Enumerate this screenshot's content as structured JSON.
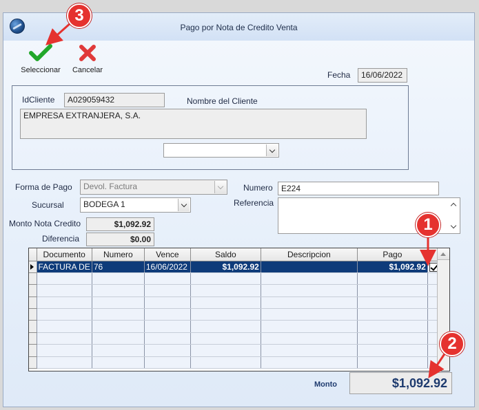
{
  "window": {
    "title": "Pago por Nota de Credito Venta"
  },
  "toolbar": {
    "select_label": "Seleccionar",
    "cancel_label": "Cancelar"
  },
  "header": {
    "fecha_label": "Fecha",
    "fecha_value": "16/06/2022"
  },
  "client": {
    "id_label": "IdCliente",
    "id_value": "A029059432",
    "name_label": "Nombre del Cliente",
    "name_value": "EMPRESA EXTRANJERA, S.A.",
    "combo_value": ""
  },
  "payment": {
    "forma_label": "Forma de Pago",
    "forma_value": "Devol. Factura",
    "sucursal_label": "Sucursal",
    "sucursal_value": "BODEGA 1",
    "numero_label": "Numero",
    "numero_value": "E224",
    "referencia_label": "Referencia",
    "referencia_value": "",
    "monto_nc_label": "Monto Nota Credito",
    "monto_nc_value": "$1,092.92",
    "diferencia_label": "Diferencia",
    "diferencia_value": "$0.00"
  },
  "grid": {
    "columns": [
      "Documento",
      "Numero",
      "Vence",
      "Saldo",
      "Descripcion",
      "Pago"
    ],
    "rows": [
      {
        "documento": "FACTURA DE",
        "numero": "76",
        "vence": "16/06/2022",
        "saldo": "$1,092.92",
        "descripcion": "",
        "pago": "$1,092.92",
        "checked": true
      }
    ]
  },
  "footer": {
    "monto_label": "Monto",
    "monto_value": "$1,092.92"
  },
  "annotations": [
    "1",
    "2",
    "3"
  ],
  "colors": {
    "accent": "#0e3b7a",
    "annotation": "#e5322f",
    "check_green": "#22a72a",
    "cancel_red": "#e03a3a"
  }
}
